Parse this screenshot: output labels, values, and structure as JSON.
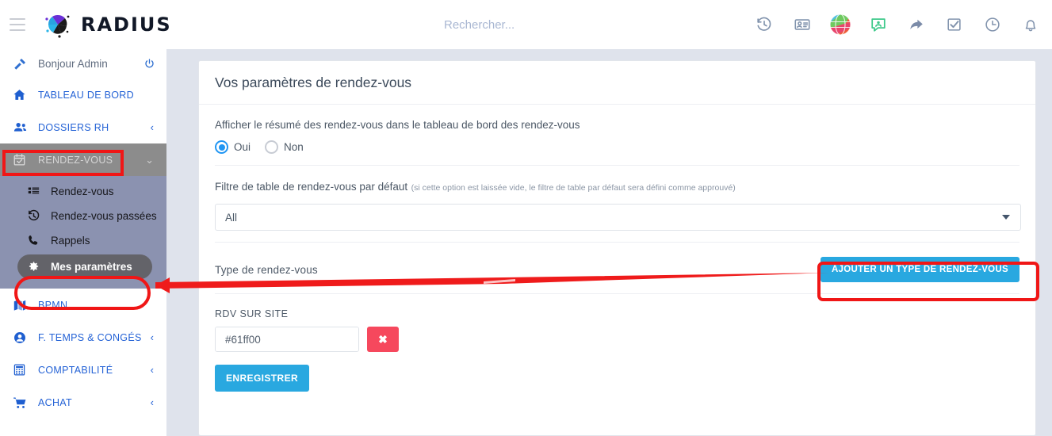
{
  "topbar": {
    "menu_icon": "hamburger-icon",
    "brand": "RADIUS",
    "search_placeholder": "Rechercher...",
    "search_value": "",
    "icons": [
      {
        "name": "history-icon",
        "glyph": "history"
      },
      {
        "name": "contact-card-icon",
        "glyph": "card"
      },
      {
        "name": "globe-colored-icon",
        "glyph": "globe"
      },
      {
        "name": "chat-user-icon",
        "glyph": "chat"
      },
      {
        "name": "share-arrow-icon",
        "glyph": "arrow"
      },
      {
        "name": "checkbox-task-icon",
        "glyph": "check"
      },
      {
        "name": "clock-icon",
        "glyph": "clock"
      },
      {
        "name": "bell-notification-icon",
        "glyph": "bell"
      }
    ]
  },
  "sidebar": {
    "greeting": "Bonjour Admin",
    "greeting_icon": "gavel-icon",
    "power_icon": "power-icon",
    "items": [
      {
        "label": "TABLEAU DE BORD",
        "icon": "home-icon",
        "chevron": "",
        "state": "normal"
      },
      {
        "label": "DOSSIERS RH",
        "icon": "users-icon",
        "chevron": "‹",
        "state": "normal"
      },
      {
        "label": "RENDEZ-VOUS",
        "icon": "calendar-check-icon",
        "chevron": "⌄",
        "state": "active-group"
      }
    ],
    "submenu": [
      {
        "label": "Rendez-vous",
        "icon": "list-icon",
        "selected": false
      },
      {
        "label": "Rendez-vous passées",
        "icon": "history-icon",
        "selected": false
      },
      {
        "label": "Rappels",
        "icon": "phone-icon",
        "selected": false
      },
      {
        "label": "Mes paramètres",
        "icon": "gear-icon",
        "selected": true
      }
    ],
    "items_after": [
      {
        "label": "BPMN",
        "icon": "map-icon",
        "chevron": "",
        "state": "normal"
      },
      {
        "label": "F. TEMPS & CONGÉS",
        "icon": "user-circle-icon",
        "chevron": "‹",
        "state": "normal"
      },
      {
        "label": "COMPTABILITÉ",
        "icon": "calculator-icon",
        "chevron": "‹",
        "state": "normal"
      },
      {
        "label": "ACHAT",
        "icon": "cart-icon",
        "chevron": "‹",
        "state": "normal"
      }
    ]
  },
  "card": {
    "title": "Vos paramètres de rendez-vous",
    "summary": {
      "label": "Afficher le résumé des rendez-vous dans le tableau de bord des rendez-vous",
      "options": [
        {
          "label": "Oui",
          "selected": true
        },
        {
          "label": "Non",
          "selected": false
        }
      ]
    },
    "filter": {
      "label": "Filtre de table de rendez-vous par défaut",
      "hint": "(si cette option est laissée vide, le filtre de table par défaut sera défini comme approuvé)",
      "value": "All"
    },
    "types": {
      "label": "Type de rendez-vous",
      "add_button": "AJOUTER UN TYPE DE RENDEZ-VOUS",
      "entries": [
        {
          "name": "RDV SUR SITE",
          "color_value": "#61ff00",
          "swatch_color": "#61ff00",
          "delete_label": "✖"
        }
      ]
    },
    "save_button": "ENREGISTRER"
  },
  "annotations": {
    "highlight_color": "#f01616",
    "boxes": [
      "rendez-vous-menu",
      "mes-parametres-item",
      "ajouter-type-button"
    ],
    "arrow": "arrow-from-button-to-mes-parametres"
  }
}
